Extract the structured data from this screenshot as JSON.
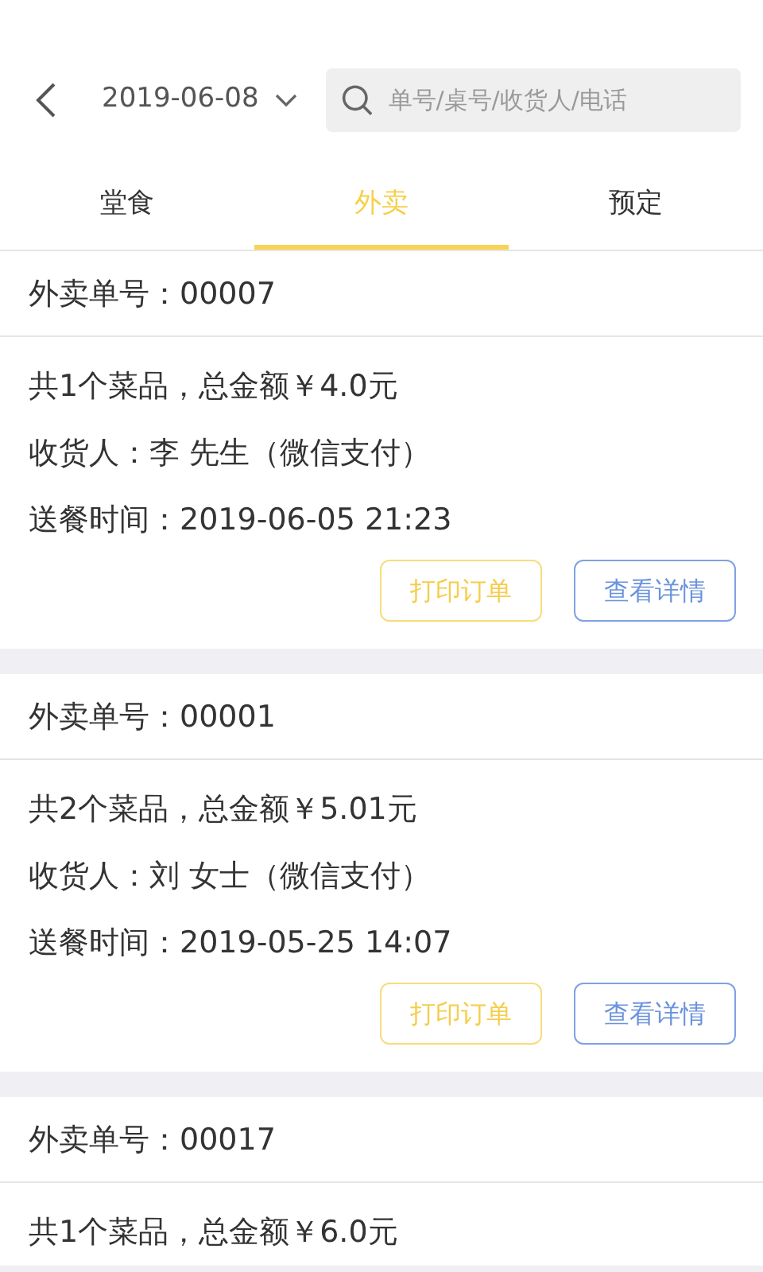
{
  "header": {
    "date": "2019-06-08",
    "search": {
      "placeholder": "单号/桌号/收货人/电话"
    }
  },
  "tabs": [
    {
      "label": "堂食",
      "selected": false
    },
    {
      "label": "外卖",
      "selected": true
    },
    {
      "label": "预定",
      "selected": false
    }
  ],
  "orders": [
    {
      "title": "外卖单号：00007",
      "lines": [
        "共1个菜品，总金额￥4.0元",
        "收货人：李 先生（微信支付）",
        "送餐时间：2019-06-05 21:23"
      ],
      "buttons": [
        {
          "label": "打印订单",
          "kind": "print"
        },
        {
          "label": "查看详情",
          "kind": "detail"
        }
      ]
    },
    {
      "title": "外卖单号：00001",
      "lines": [
        "共2个菜品，总金额￥5.01元",
        "收货人：刘 女士（微信支付）",
        "送餐时间：2019-05-25 14:07"
      ],
      "buttons": [
        {
          "label": "打印订单",
          "kind": "print"
        },
        {
          "label": "查看详情",
          "kind": "detail"
        }
      ]
    },
    {
      "title": "外卖单号：00017",
      "lines": [
        "共1个菜品，总金额￥6.0元"
      ]
    }
  ]
}
